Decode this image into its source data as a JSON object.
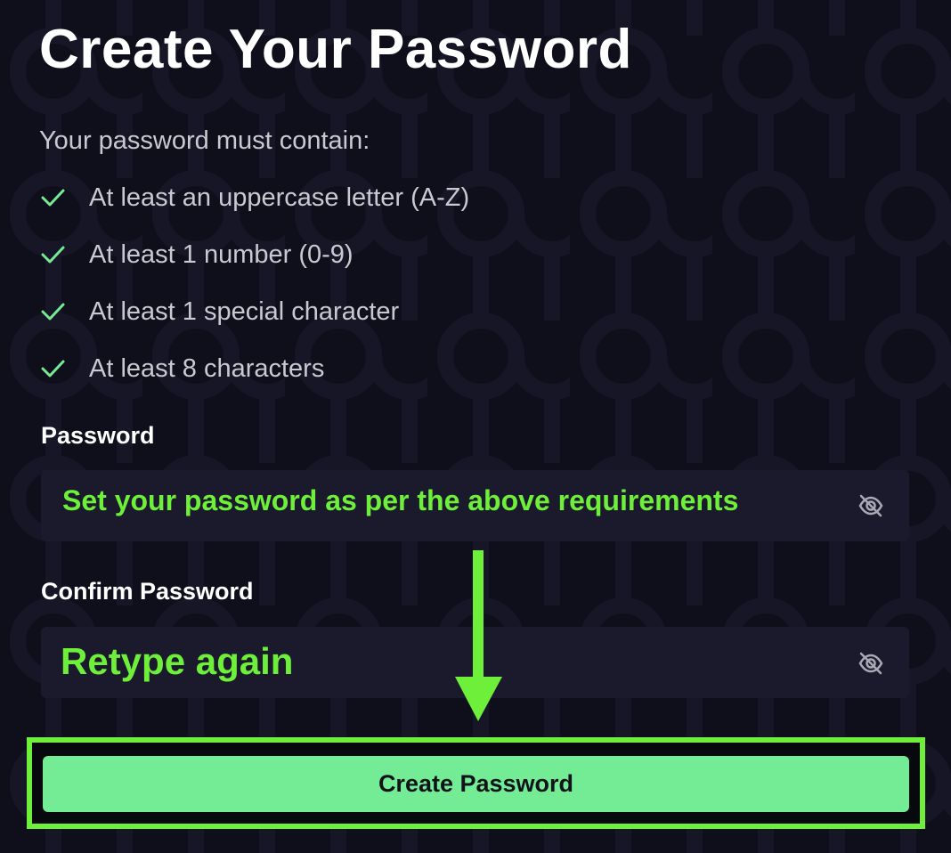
{
  "heading": "Create Your Password",
  "requirements": {
    "intro": "Your password must contain:",
    "items": [
      {
        "label": "At least an uppercase letter (A-Z)",
        "met": true
      },
      {
        "label": "At least 1 number (0-9)",
        "met": true
      },
      {
        "label": "At least 1 special character",
        "met": true
      },
      {
        "label": "At least 8 characters",
        "met": true
      }
    ]
  },
  "password": {
    "label": "Password",
    "annotation": "Set your password as per the above requirements",
    "icon": "eye-off-icon"
  },
  "confirm_password": {
    "label": "Confirm Password",
    "annotation": "Retype again",
    "icon": "eye-off-icon"
  },
  "submit_label": "Create Password",
  "colors": {
    "background": "#0f0f1c",
    "input_background": "#1a1a2c",
    "check": "#74ec95",
    "annotation": "#6ef03a",
    "button": "#74ec95"
  }
}
